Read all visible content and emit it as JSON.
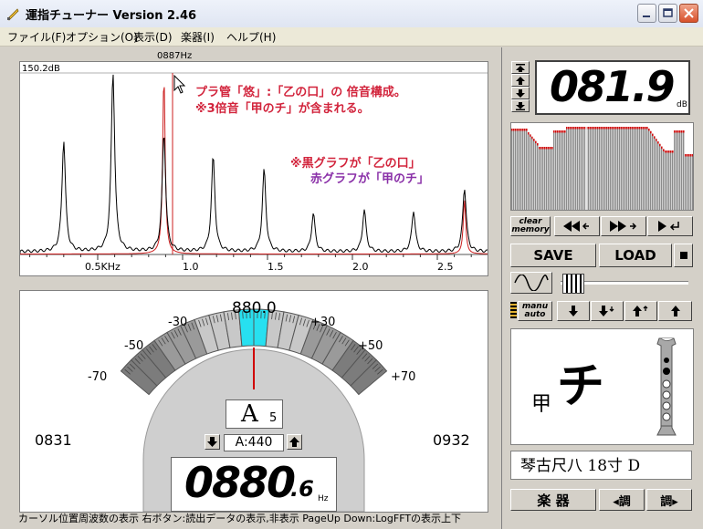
{
  "window": {
    "title": "運指チューナー  Version 2.46"
  },
  "menu": [
    {
      "label": "ファイル(F)"
    },
    {
      "label": "オプション(O)"
    },
    {
      "label": "表示(D)"
    },
    {
      "label": "楽器(I)"
    },
    {
      "label": "ヘルプ(H)"
    }
  ],
  "spectrum": {
    "peak_db_label": "150.2dB",
    "cursor_freq_label": "0887Hz",
    "annotation_line1": "プラ管「悠」:「乙の口」の 倍音構成。",
    "annotation_line2": "※3倍音「甲のチ」が含まれる。",
    "legend_line1": "※黒グラフが「乙の口」",
    "legend_line2": "赤グラフが「甲のチ」",
    "x_ticks": [
      "0.5KHz",
      "1.0",
      "1.5",
      "2.0",
      "2.5"
    ],
    "peaks_khz": [
      0.3,
      0.59,
      0.89,
      1.18,
      1.48,
      1.77,
      2.07,
      2.36,
      2.66
    ],
    "colors": {
      "black_series": "#000000",
      "red_series": "#cc1f1f"
    }
  },
  "tuner": {
    "center_freq": "880.0",
    "scale_labels": [
      "-70",
      "-50",
      "-30",
      "+30",
      "+50",
      "+70"
    ],
    "left_freq": "0831",
    "right_freq": "0932",
    "note_letter": "A",
    "note_octave": "5",
    "reference": "A:440",
    "freq_main": "0880",
    "freq_decimal": ".6",
    "freq_unit": "Hz",
    "highlight_color": "#27e0f0"
  },
  "status_text": "カーソル位置周波数の表示  右ボタン:読出データの表示,非表示  PageUp Down:LogFFTの表示上下",
  "right": {
    "db_value": "081.9",
    "db_unit": "dB",
    "clear_memory_top": "clear",
    "clear_memory_bottom": "memory",
    "save_label": "SAVE",
    "load_label": "LOAD",
    "manu_label": "manu",
    "auto_label": "auto",
    "fingering_small": "甲",
    "fingering_big": "チ",
    "instrument": "琴古尺八 18寸 D",
    "instrument_button": "楽 器",
    "tune_down_label": "◂調",
    "tune_up_label": "調▸"
  }
}
